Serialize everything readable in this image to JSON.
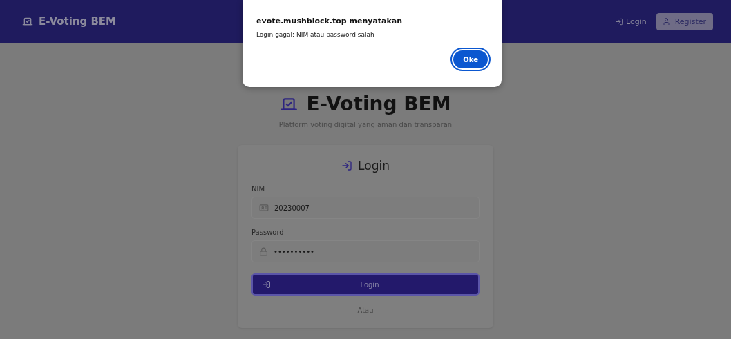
{
  "navbar": {
    "brand": "E-Voting BEM",
    "links": [
      {
        "label": "Login",
        "kind": "link"
      },
      {
        "label": "Register",
        "kind": "button"
      }
    ]
  },
  "hero": {
    "title": "E-Voting BEM",
    "subtitle": "Platform voting digital yang aman dan transparan"
  },
  "login_card": {
    "title": "Login",
    "fields": [
      {
        "label": "NIM",
        "value": "20230007",
        "kind": "id"
      },
      {
        "label": "Password",
        "value": "••••••••••",
        "kind": "lock"
      }
    ],
    "submit": "Login",
    "divider": "Atau"
  },
  "dialog": {
    "title": "evote.mushblock.top menyatakan",
    "message": "Login gagal: NIM atau password salah",
    "button": "Oke"
  }
}
